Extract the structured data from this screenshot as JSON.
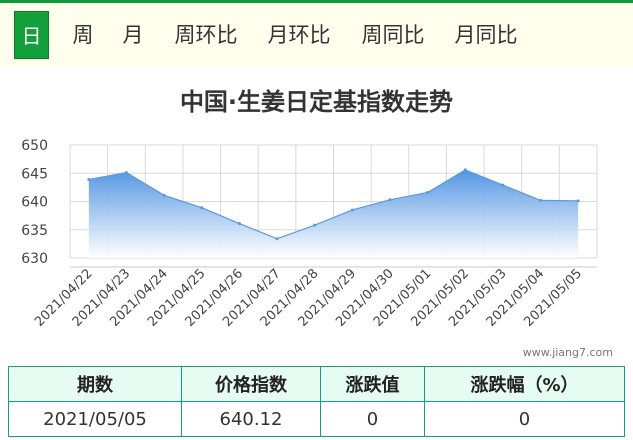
{
  "tabs": [
    {
      "label": "日",
      "active": true
    },
    {
      "label": "周",
      "active": false
    },
    {
      "label": "月",
      "active": false
    },
    {
      "label": "周环比",
      "active": false
    },
    {
      "label": "月环比",
      "active": false
    },
    {
      "label": "周同比",
      "active": false
    },
    {
      "label": "月同比",
      "active": false
    }
  ],
  "watermark": "www.jiang7.com",
  "table": {
    "headers": [
      "期数",
      "价格指数",
      "涨跌值",
      "涨跌幅（%）"
    ],
    "row": [
      "2021/05/05",
      "640.12",
      "0",
      "0"
    ]
  },
  "colors": {
    "tab_active": "#13a03a",
    "accent_border": "#0d9a3a",
    "series_line": "#5b9bd5",
    "table_border": "#1a9b8a"
  },
  "chart_data": {
    "type": "area",
    "title": "中国·生姜日定基指数走势",
    "categories": [
      "2021/04/22",
      "2021/04/23",
      "2021/04/24",
      "2021/04/25",
      "2021/04/26",
      "2021/04/27",
      "2021/04/28",
      "2021/04/29",
      "2021/04/30",
      "2021/05/01",
      "2021/05/02",
      "2021/05/03",
      "2021/05/04",
      "2021/05/05"
    ],
    "series": [
      {
        "values": [
          643.9,
          645.1,
          641.1,
          638.9,
          636.1,
          633.4,
          635.8,
          638.5,
          640.3,
          641.6,
          645.6,
          642.9,
          640.2,
          640.12
        ]
      }
    ],
    "yticks": [
      "650",
      "645",
      "640",
      "635",
      "630"
    ],
    "ylim": [
      630,
      650
    ],
    "grid": true
  }
}
